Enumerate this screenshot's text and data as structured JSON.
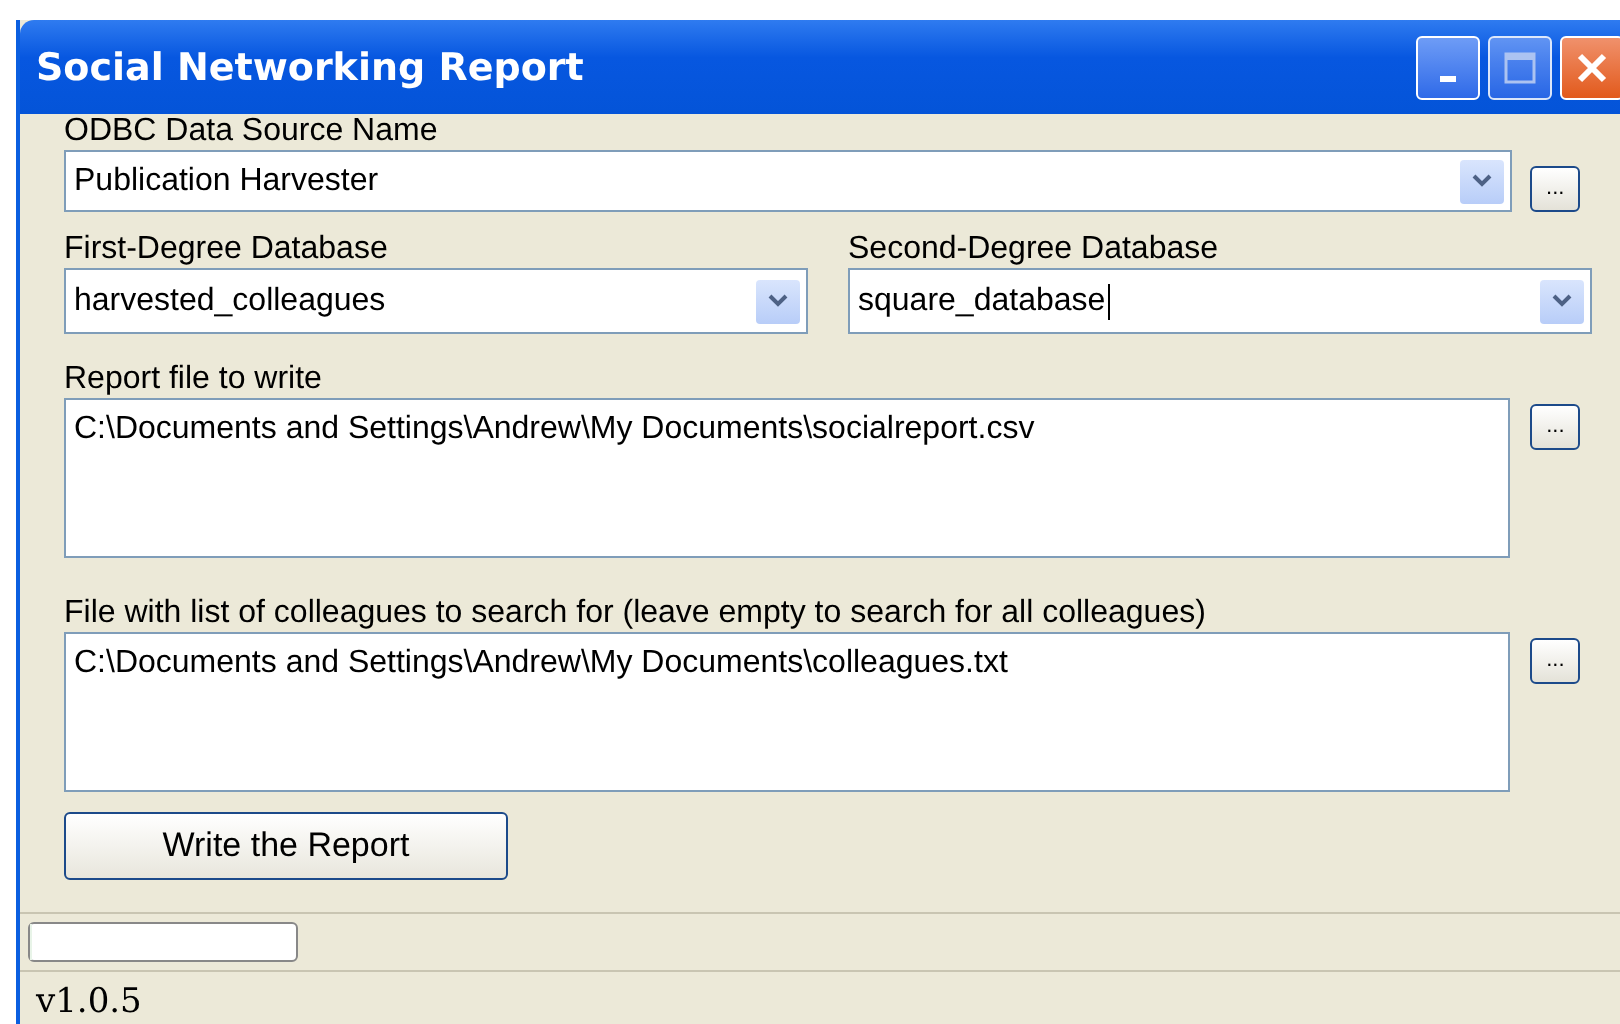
{
  "window": {
    "title": "Social Networking Report"
  },
  "odbc": {
    "label": "ODBC Data Source Name",
    "value": "Publication Harvester",
    "browse": "..."
  },
  "first_db": {
    "label": "First-Degree Database",
    "value": "harvested_colleagues"
  },
  "second_db": {
    "label": "Second-Degree Database",
    "value": "square_database"
  },
  "report_file": {
    "label": "Report file to write",
    "value": "C:\\Documents and Settings\\Andrew\\My Documents\\socialreport.csv",
    "browse": "..."
  },
  "colleague_file": {
    "label": "File with list of colleagues to search for (leave empty to search for all colleagues)",
    "value": "C:\\Documents and Settings\\Andrew\\My Documents\\colleagues.txt",
    "browse": "..."
  },
  "write_button": "Write the Report",
  "progress": {
    "level": 0
  },
  "status_bar": "v1.0.5"
}
